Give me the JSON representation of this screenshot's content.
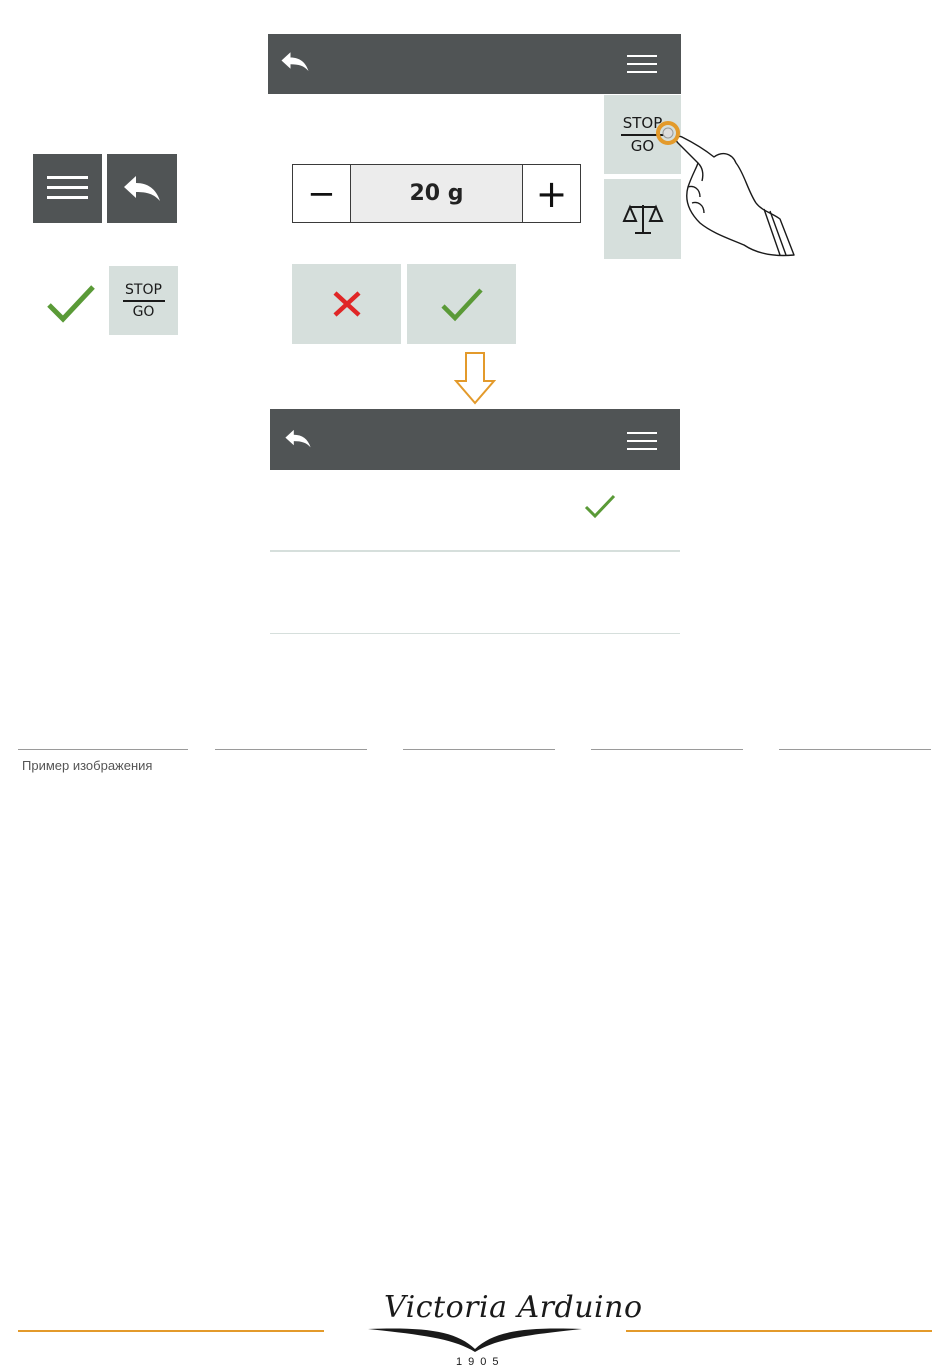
{
  "legend": {
    "stop_label": "STOP",
    "go_label": "GO"
  },
  "screen1": {
    "back_icon": "back-arrow-icon",
    "menu_icon": "hamburger-menu-icon",
    "stop_label": "STOP",
    "go_label": "GO",
    "scale_icon": "scale-icon",
    "stepper": {
      "minus": "−",
      "value": "20 g",
      "plus": "+"
    },
    "cancel_icon": "cross-icon",
    "confirm_icon": "check-icon"
  },
  "screen2": {
    "back_icon": "back-arrow-icon",
    "menu_icon": "hamburger-menu-icon",
    "row1_check_icon": "check-icon"
  },
  "caption": "Пример изображения",
  "footer": {
    "brand": "Victoria Arduino",
    "year": "1905"
  },
  "colors": {
    "header": "#505455",
    "tile": "#d6dfdc",
    "check": "#5a9a37",
    "cross": "#e02626",
    "accent": "#e39a2b"
  }
}
